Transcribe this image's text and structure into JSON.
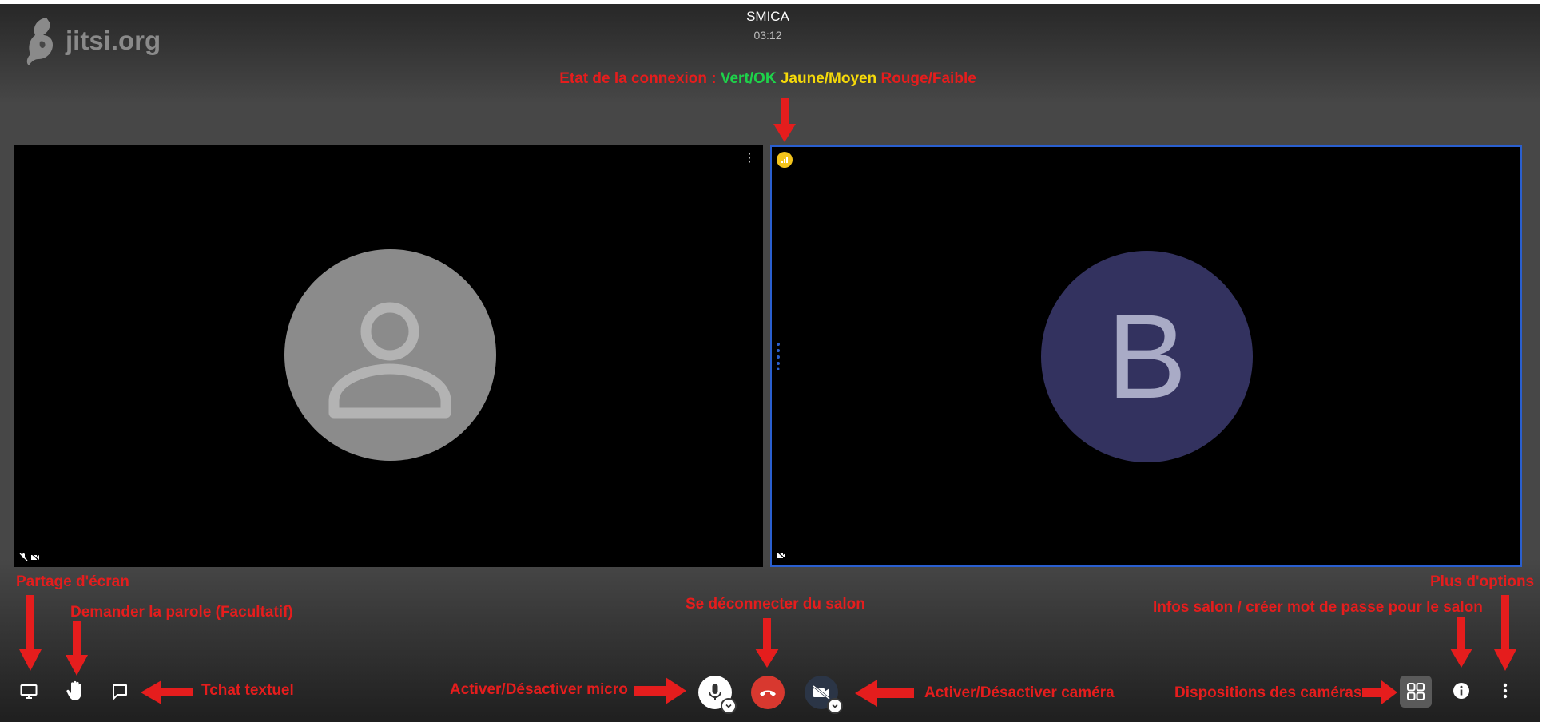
{
  "meeting": {
    "logo_text": "jitsi.org",
    "room_name": "SMICA",
    "timer": "03:12"
  },
  "connection_legend": {
    "label": "Etat de la connexion : ",
    "good": "Vert/OK",
    "medium": "Jaune/Moyen",
    "poor": "Rouge/Faible"
  },
  "participants": [
    {
      "avatar": "person-icon",
      "letter": ""
    },
    {
      "avatar": "letter",
      "letter": "B"
    }
  ],
  "annotations": {
    "screen_share": "Partage d'écran",
    "raise_hand": "Demander la parole (Facultatif)",
    "chat": "Tchat textuel",
    "mic": "Activer/Désactiver micro",
    "hangup": "Se déconnecter du salon",
    "camera": "Activer/Désactiver caméra",
    "layouts": "Dispositions des caméras",
    "info": "Infos salon / créer mot de passe pour le salon",
    "more": "Plus d'options"
  },
  "toolbar": {
    "icons": [
      "screen-share-icon",
      "raise-hand-icon",
      "chat-icon",
      "microphone-icon",
      "hangup-icon",
      "camera-off-icon",
      "tile-view-icon",
      "info-icon",
      "more-options-icon"
    ]
  },
  "colors": {
    "annotation_red": "#e51d1d",
    "status_green": "#1ed24a",
    "status_yellow": "#f5d90a",
    "hangup_red": "#d8382f",
    "avatar_blue": "#33325f",
    "active_border": "#2a5fcf"
  }
}
